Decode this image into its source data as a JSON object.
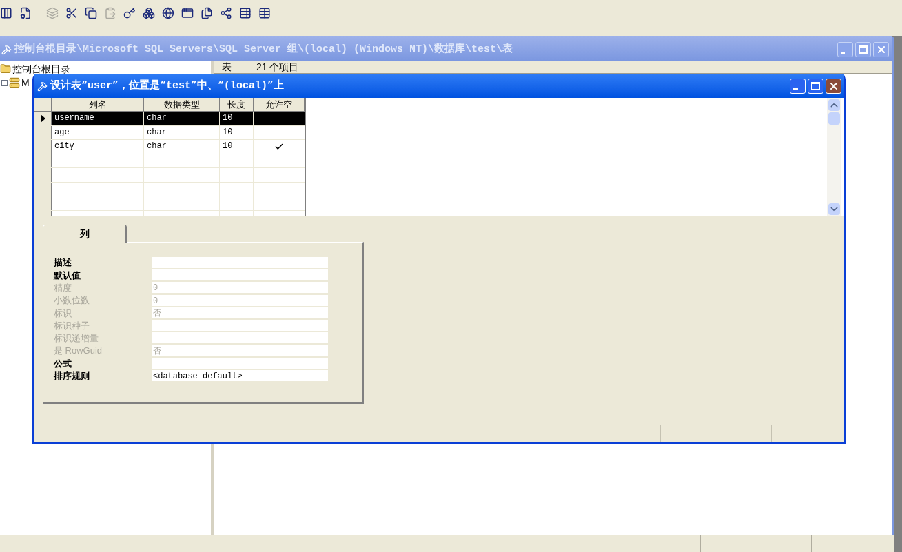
{
  "toolbar": {
    "buttons": [
      {
        "kind": "columns",
        "disabled": false
      },
      {
        "kind": "properties",
        "disabled": false
      },
      {
        "kind": "generate",
        "disabled": true
      },
      {
        "kind": "cut",
        "disabled": false
      },
      {
        "kind": "copy",
        "disabled": false
      },
      {
        "kind": "paste",
        "disabled": true
      },
      {
        "kind": "key",
        "disabled": false
      },
      {
        "kind": "relations",
        "disabled": false
      },
      {
        "kind": "globe",
        "disabled": false
      },
      {
        "kind": "window",
        "disabled": false
      },
      {
        "kind": "indexes",
        "disabled": false
      },
      {
        "kind": "tree",
        "disabled": false
      },
      {
        "kind": "edit",
        "disabled": false
      },
      {
        "kind": "table",
        "disabled": false
      }
    ]
  },
  "main_window": {
    "title": "控制台根目录\\Microsoft SQL Servers\\SQL Server 组\\(local) (Windows NT)\\数据库\\test\\表",
    "active": false,
    "tree": [
      {
        "label": "控制台根目录",
        "kind": "folder",
        "children": [
          {
            "label": "M",
            "kind": "server",
            "expanded": true
          }
        ]
      }
    ],
    "list_header": {
      "title": "表",
      "count": "21 个项目"
    }
  },
  "design_window": {
    "title": "设计表“user”，位置是“test”中、“(local)”上",
    "active": true,
    "columns": [
      "列名",
      "数据类型",
      "长度",
      "允许空"
    ],
    "rows": [
      {
        "name": "username",
        "type": "char",
        "length": "10",
        "allow_null": false,
        "selected": true
      },
      {
        "name": "age",
        "type": "char",
        "length": "10",
        "allow_null": false,
        "selected": false
      },
      {
        "name": "city",
        "type": "char",
        "length": "10",
        "allow_null": true,
        "selected": false
      }
    ],
    "tabs": [
      {
        "label": "列",
        "selected": true
      }
    ],
    "properties": [
      {
        "label": "描述",
        "disabled": false
      },
      {
        "label": "默认值",
        "disabled": false
      },
      {
        "label": "精度",
        "value": "0",
        "disabled": true
      },
      {
        "label": "小数位数",
        "value": "0",
        "disabled": true
      },
      {
        "label": "标识",
        "value": "否",
        "disabled": true
      },
      {
        "label": "标识种子",
        "disabled": true
      },
      {
        "label": "标识递增量",
        "disabled": true
      },
      {
        "label": "是 RowGuid",
        "value": "否",
        "disabled": true
      },
      {
        "label": "公式",
        "disabled": false
      },
      {
        "label": "排序规则",
        "value": "<database default>",
        "disabled": false
      }
    ]
  }
}
